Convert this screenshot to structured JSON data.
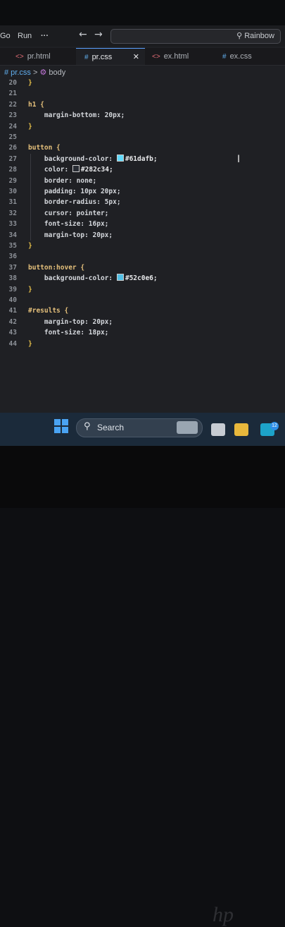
{
  "menu": {
    "go": "Go",
    "run": "Run",
    "more": "···"
  },
  "nav": {
    "back": "←",
    "forward": "→"
  },
  "search": {
    "icon": "search-icon",
    "label": "Rainbow"
  },
  "tabs": [
    {
      "icon": "<>",
      "label": "pr.html",
      "active": false
    },
    {
      "icon": "#",
      "label": "pr.css",
      "active": true,
      "close": "✕"
    },
    {
      "icon": "<>",
      "label": "ex.html",
      "active": false
    },
    {
      "icon": "#",
      "label": "ex.css",
      "active": false
    }
  ],
  "breadcrumb": {
    "file": "# pr.css",
    "sep": ">",
    "symbol": "body"
  },
  "code_lines": [
    {
      "n": "20",
      "text": "}"
    },
    {
      "n": "21",
      "text": ""
    },
    {
      "n": "22",
      "text": "h1 {"
    },
    {
      "n": "23",
      "text": "    margin-bottom: 20px;"
    },
    {
      "n": "24",
      "text": "}"
    },
    {
      "n": "25",
      "text": ""
    },
    {
      "n": "26",
      "text": "button {"
    },
    {
      "n": "27",
      "text": "    background-color: #61dafb;"
    },
    {
      "n": "28",
      "text": "    color: #282c34;"
    },
    {
      "n": "29",
      "text": "    border: none;"
    },
    {
      "n": "30",
      "text": "    padding: 10px 20px;"
    },
    {
      "n": "31",
      "text": "    border-radius: 5px;"
    },
    {
      "n": "32",
      "text": "    cursor: pointer;"
    },
    {
      "n": "33",
      "text": "    font-size: 16px;"
    },
    {
      "n": "34",
      "text": "    margin-top: 20px;"
    },
    {
      "n": "35",
      "text": "}"
    },
    {
      "n": "36",
      "text": ""
    },
    {
      "n": "37",
      "text": "button:hover {"
    },
    {
      "n": "38",
      "text": "    background-color: #52c0e6;"
    },
    {
      "n": "39",
      "text": "}"
    },
    {
      "n": "40",
      "text": ""
    },
    {
      "n": "41",
      "text": "#results {"
    },
    {
      "n": "42",
      "text": "    margin-top: 20px;"
    },
    {
      "n": "43",
      "text": "    font-size: 18px;"
    },
    {
      "n": "44",
      "text": "}"
    }
  ],
  "swatches": {
    "61dafb": "#61dafb",
    "282c34": "#282c34",
    "52c0e6": "#52c0e6"
  },
  "taskbar": {
    "search_label": "Search",
    "notification_count": "12"
  },
  "brand": "hp",
  "colors": {
    "accent": "#5aa0ff",
    "editor_bg": "#1f2024",
    "taskbar_bg": "#1b2a3a"
  }
}
